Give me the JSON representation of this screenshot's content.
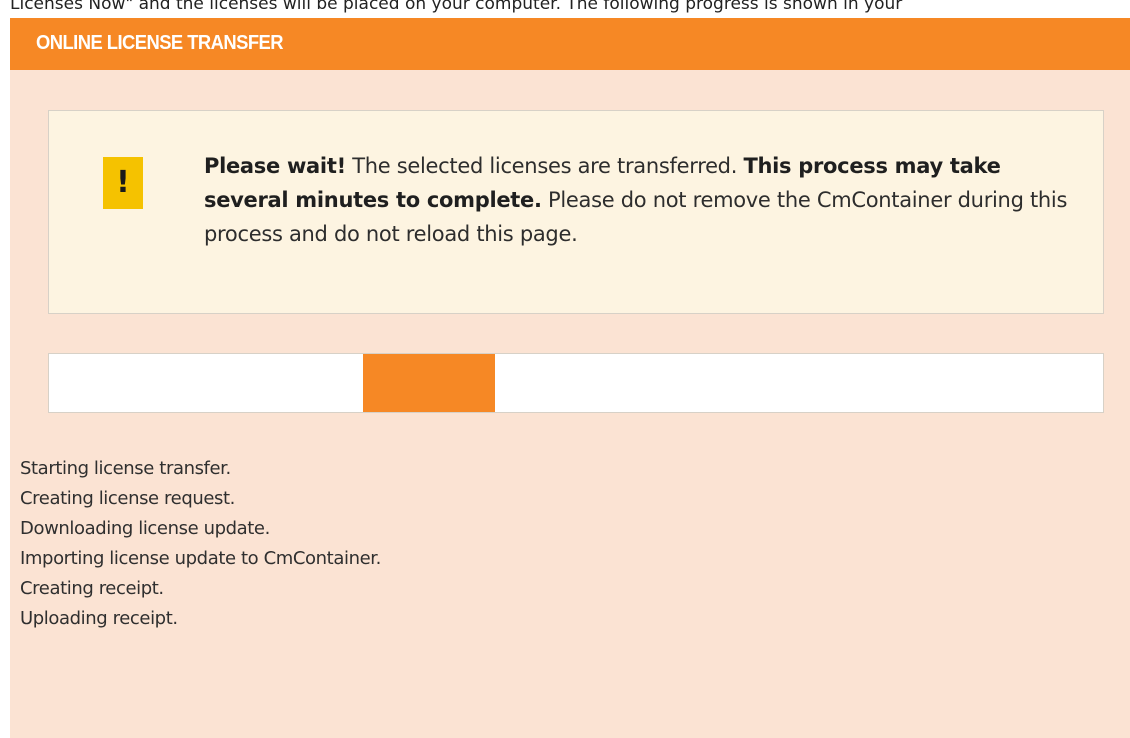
{
  "intro": {
    "text": "Licenses Now\" and the licenses will be placed on your computer. The following progress is shown in your"
  },
  "panel": {
    "title": "ONLINE LICENSE TRANSFER"
  },
  "notice": {
    "icon": "warning-exclamation-icon",
    "icon_glyph": "!",
    "icon_color": "#f5c200",
    "lead_bold": "Please wait!",
    "text_1": " The selected licenses are transferred. ",
    "emphasis_bold": "This process may take several minutes to complete.",
    "text_2": " Please do not remove the CmContainer during this process and do not reload this page."
  },
  "progress": {
    "state": "indeterminate",
    "indicator_start": 0.298,
    "indicator_end": 0.423,
    "color": "#f68825"
  },
  "log": {
    "lines": [
      "Starting license transfer.",
      "Creating license request.",
      "Downloading license update.",
      "Importing license update to CmContainer.",
      "Creating receipt.",
      "Uploading receipt."
    ]
  },
  "colors": {
    "accent": "#f68825",
    "panel_background": "#fbe3d3",
    "notice_background": "#fdf4e1"
  }
}
